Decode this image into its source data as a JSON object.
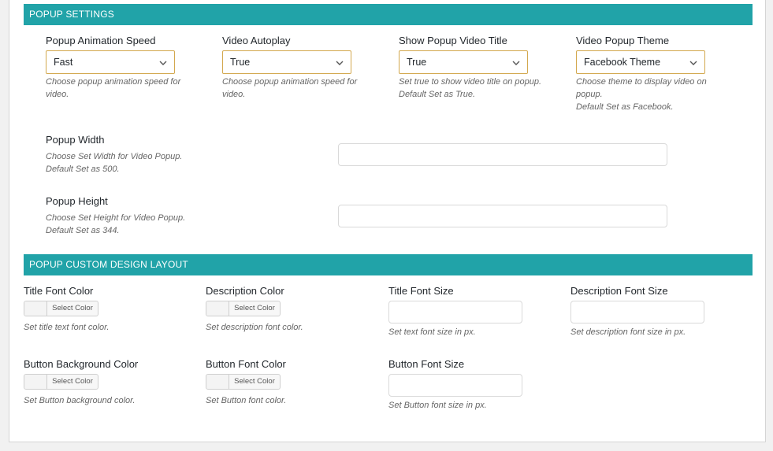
{
  "popup_settings": {
    "header": "POPUP SETTINGS",
    "animation_speed": {
      "label": "Popup Animation Speed",
      "value": "Fast",
      "desc": "Choose popup animation speed for\nvideo."
    },
    "video_autoplay": {
      "label": "Video Autoplay",
      "value": "True",
      "desc": "Choose popup animation speed for\nvideo."
    },
    "show_title": {
      "label": "Show Popup Video Title",
      "value": "True",
      "desc": "Set true to show video title on popup.\nDefault Set as True."
    },
    "theme": {
      "label": "Video Popup Theme",
      "value": "Facebook Theme",
      "desc": "Choose theme to display video on\npopup.\nDefault Set as Facebook."
    },
    "width": {
      "label": "Popup Width",
      "desc": "Choose Set Width for Video Popup.\nDefault Set as 500.",
      "value": ""
    },
    "height": {
      "label": "Popup Height",
      "desc": "Choose Set Height for Video Popup.\nDefault Set as 344.",
      "value": ""
    }
  },
  "custom_design": {
    "header": "POPUP CUSTOM DESIGN LAYOUT",
    "select_color_label": "Select Color",
    "title_font_color": {
      "label": "Title Font Color",
      "desc": "Set title text font color."
    },
    "description_color": {
      "label": "Description Color",
      "desc": "Set description font color."
    },
    "title_font_size": {
      "label": "Title Font Size",
      "desc": "Set text font size in px.",
      "value": ""
    },
    "description_font_size": {
      "label": "Description Font Size",
      "desc": "Set description font size in px.",
      "value": ""
    },
    "button_bg_color": {
      "label": "Button Background Color",
      "desc": "Set Button background color."
    },
    "button_font_color": {
      "label": "Button Font Color",
      "desc": "Set Button font color."
    },
    "button_font_size": {
      "label": "Button Font Size",
      "desc": "Set Button font size in px.",
      "value": ""
    }
  },
  "colors": {
    "accent": "#21a3a8",
    "select_border": "#d3a84e"
  },
  "icons": {
    "select_arrow": "chevron-down-icon"
  }
}
